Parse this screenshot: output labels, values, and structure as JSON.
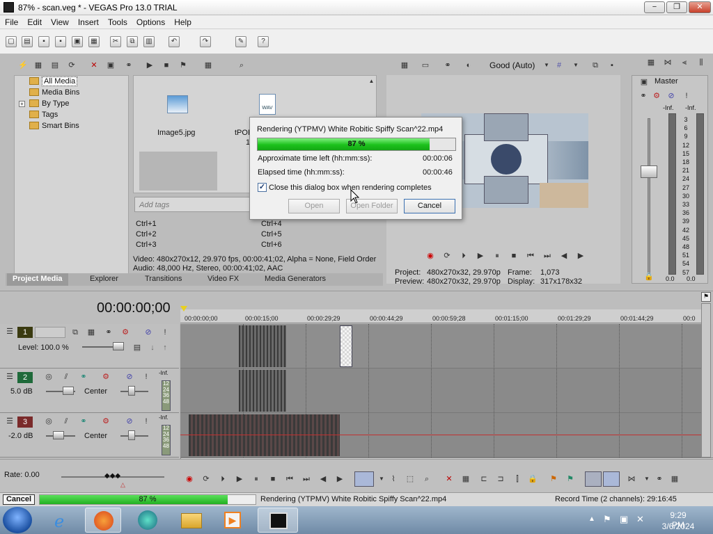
{
  "window": {
    "title": "87% - scan.veg * - VEGAS Pro 13.0 TRIAL",
    "min": "−",
    "max": "❐",
    "close": "✕"
  },
  "menu": [
    "File",
    "Edit",
    "View",
    "Insert",
    "Tools",
    "Options",
    "Help"
  ],
  "explorer": {
    "tree": [
      "All Media",
      "Media Bins",
      "By Type",
      "Tags",
      "Smart Bins"
    ],
    "files": [
      {
        "name": "Image5.jpg"
      },
      {
        "name": "tPOR",
        "sub": "1"
      }
    ],
    "wav_label": "WAV",
    "tags_placeholder": "Add tags",
    "shortcuts_left": [
      "Ctrl+1",
      "Ctrl+2",
      "Ctrl+3"
    ],
    "shortcuts_right": [
      "Ctrl+4",
      "Ctrl+5",
      "Ctrl+6"
    ],
    "info_video": "Video: 480x270x12, 29.970 fps, 00:00:41;02, Alpha = None, Field Order",
    "info_audio": "Audio: 48,000 Hz, Stereo, 00:00:41;02, AAC",
    "tabs": [
      "Project Media",
      "Explorer",
      "Transitions",
      "Video FX",
      "Media Generators"
    ]
  },
  "preview": {
    "quality": "Good (Auto)",
    "project_label": "Project:",
    "project_value": "480x270x32, 29.970p",
    "preview_label": "Preview:",
    "preview_value": "480x270x32, 29.970p",
    "frame_label": "Frame:",
    "frame_value": "1,073",
    "display_label": "Display:",
    "display_value": "317x178x32"
  },
  "master": {
    "title": "Master",
    "inf_left": "-Inf.",
    "inf_right": "-Inf.",
    "ticks": [
      "3",
      "6",
      "9",
      "12",
      "15",
      "18",
      "21",
      "24",
      "27",
      "30",
      "33",
      "36",
      "39",
      "42",
      "45",
      "48",
      "51",
      "54",
      "57"
    ],
    "bottom_left": "0.0",
    "bottom_right": "0.0"
  },
  "timeline": {
    "timecode": "00:00:00;00",
    "ruler": [
      "00:00:00;00",
      "00:00:15;00",
      "00:00:29;29",
      "00:00:44;29",
      "00:00:59;28",
      "00:01:15;00",
      "00:01:29;29",
      "00:01:44;29",
      "00:0"
    ],
    "tracks": [
      {
        "num": "1",
        "label": "Level: 100.0 %",
        "color": "#3a3a10"
      },
      {
        "num": "2",
        "label": "5.0 dB",
        "pan": "Center",
        "inf": "-Inf.",
        "levels": [
          "12",
          "24",
          "36",
          "48"
        ],
        "color": "#1f6a3a"
      },
      {
        "num": "3",
        "label": "-2.0 dB",
        "pan": "Center",
        "inf": "-Inf.",
        "levels": [
          "12",
          "24",
          "36",
          "48"
        ],
        "color": "#7a2a2a"
      }
    ],
    "rate": "Rate: 0.00"
  },
  "dialog": {
    "title": "Rendering (YTPMV) White Robitic Spiffy Scan^22.mp4",
    "progress": 0.87,
    "progress_text": "87 %",
    "time_left_label": "Approximate time left (hh:mm:ss):",
    "time_left": "00:00:06",
    "elapsed_label": "Elapsed time (hh:mm:ss):",
    "elapsed": "00:00:46",
    "checkbox_label": "Close this dialog box when rendering completes",
    "checkbox_checked": true,
    "open": "Open",
    "open_folder": "Open Folder",
    "cancel": "Cancel"
  },
  "statusbar": {
    "cancel": "Cancel",
    "progress": 0.87,
    "progress_text": "87 %",
    "message": "Rendering (YTPMV) White Robitic Spiffy Scan^22.mp4",
    "record_time": "Record Time (2 channels): 29:16:45"
  },
  "taskbar": {
    "time": "9:29 PM",
    "date": "3/6/2024"
  }
}
